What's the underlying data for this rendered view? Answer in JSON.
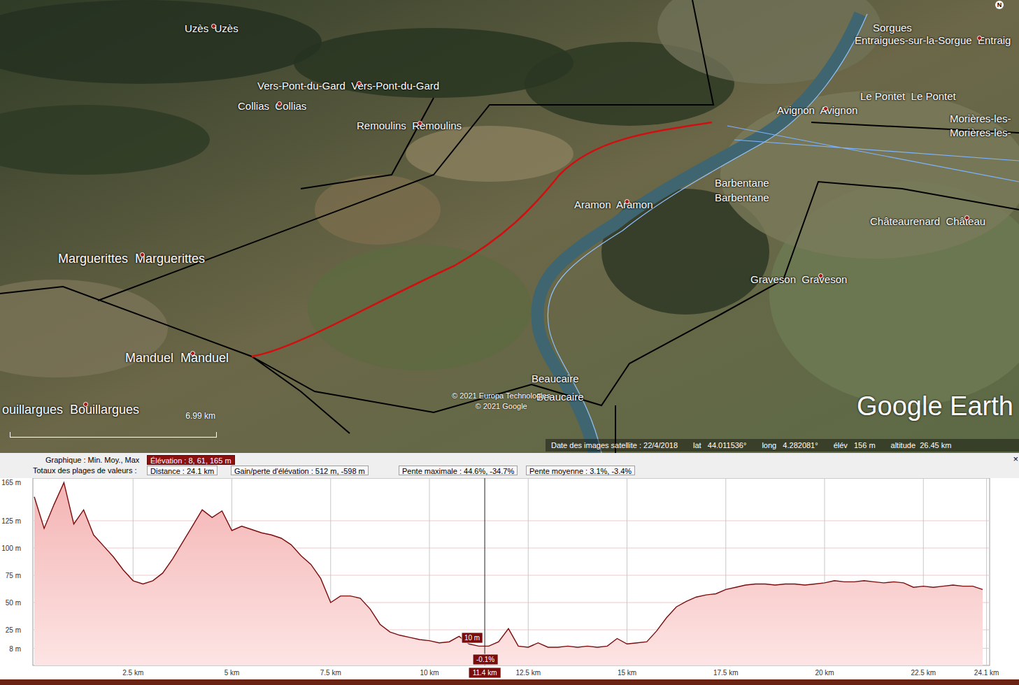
{
  "map": {
    "labels": [
      {
        "text": "Uzès  Uzès"
      },
      {
        "text": "Vers-Pont-du-Gard  Vers-Pont-du-Gard"
      },
      {
        "text": "Collias  Collias"
      },
      {
        "text": "Remoulins  Remoulins"
      },
      {
        "text": "Marguerittes  Marguerittes"
      },
      {
        "text": "Manduel  Manduel"
      },
      {
        "text": "ouillargues  Bouillargues"
      },
      {
        "text": "Aramon  Aramon"
      },
      {
        "text": "Barbentane"
      },
      {
        "text": "Barbentane"
      },
      {
        "text": "Graveson  Graveson"
      },
      {
        "text": "Châteaurenard  Château"
      },
      {
        "text": "Avignon  Avignon"
      },
      {
        "text": "Le Pontet  Le Pontet"
      },
      {
        "text": "Sorgues"
      },
      {
        "text": "Entraigues-sur-la-Sorgue  Entraig"
      },
      {
        "text": "Morières-les-"
      },
      {
        "text": "Morières-les-"
      },
      {
        "text": "Beaucaire"
      },
      {
        "text": "Beaucaire"
      }
    ],
    "compass": "N",
    "scale": "6.99  km",
    "copyright": [
      "© 2021 Europa Technologies",
      "© 2021 Google"
    ],
    "logo": "Google Earth",
    "status": [
      "Date des images satellite : 22/4/2018",
      "lat   44.011536°",
      "long   4.282081°",
      "élév   156 m",
      "altitude  26.45 km"
    ]
  },
  "profile": {
    "close": "×",
    "header_rows": [
      {
        "label": "Graphique : Min. Moy., Max",
        "boxes": [
          {
            "text": "Élévation : 8, 61, 165 m",
            "selected": true
          }
        ]
      },
      {
        "label": "Totaux des plages de valeurs :",
        "boxes": [
          {
            "text": "Distance : 24.1 km",
            "selected": false
          },
          {
            "text": "Gain/perte d'élévation : 512 m, -598 m",
            "selected": false
          },
          {
            "text": "Pente maximale : 44.6%, -34.7%",
            "selected": false
          },
          {
            "text": "Pente moyenne : 3.1%, -3.4%",
            "selected": false
          }
        ]
      }
    ],
    "y_ticks": [
      {
        "m": 165,
        "label": "165 m"
      },
      {
        "m": 125,
        "label": "125 m"
      },
      {
        "m": 100,
        "label": "100 m"
      },
      {
        "m": 75,
        "label": "75 m"
      },
      {
        "m": 50,
        "label": "50 m"
      },
      {
        "m": 25,
        "label": "25 m"
      },
      {
        "m": 8,
        "label": "8 m"
      }
    ],
    "x_ticks": [
      {
        "km": 2.5,
        "label": "2.5 km"
      },
      {
        "km": 5,
        "label": "5 km"
      },
      {
        "km": 7.5,
        "label": "7.5 km"
      },
      {
        "km": 10,
        "label": "10 km"
      },
      {
        "km": 12.5,
        "label": "12.5 km"
      },
      {
        "km": 15,
        "label": "15 km"
      },
      {
        "km": 17.5,
        "label": "17.5 km"
      },
      {
        "km": 20,
        "label": "20 km"
      },
      {
        "km": 22.5,
        "label": "22.5 km"
      },
      {
        "km": 24.1,
        "label": "24.1 km"
      }
    ],
    "step_km": 0.25,
    "values": [
      147,
      118,
      140,
      160,
      122,
      135,
      112,
      102,
      92,
      80,
      70,
      67,
      70,
      77,
      90,
      105,
      120,
      135,
      128,
      134,
      116,
      120,
      117,
      114,
      112,
      109,
      103,
      93,
      85,
      72,
      50,
      56,
      56,
      54,
      44,
      30,
      23,
      20,
      18,
      16,
      15,
      13,
      14,
      19,
      12,
      10,
      10,
      14,
      26,
      10,
      9,
      13,
      9,
      9,
      10,
      9,
      10,
      9,
      10,
      17,
      12,
      13,
      14,
      24,
      36,
      46,
      51,
      55,
      57,
      58,
      62,
      64,
      66,
      67,
      67,
      66,
      67,
      67,
      66,
      67,
      68,
      70,
      69,
      69,
      70,
      69,
      68,
      69,
      68,
      64,
      65,
      64,
      65,
      66,
      65,
      65,
      62
    ],
    "cursor": {
      "km": 11.4,
      "label": "11.4 km",
      "elevation": "10 m",
      "slope": "-0.1%"
    }
  }
}
